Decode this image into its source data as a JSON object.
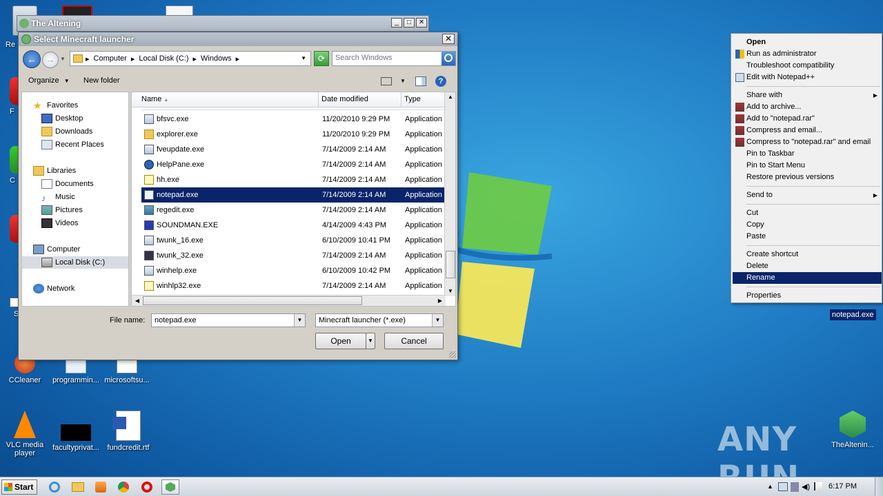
{
  "desktop": {
    "icons": [
      {
        "label": "CCleaner"
      },
      {
        "label": "programmin..."
      },
      {
        "label": "microsoftsu..."
      },
      {
        "label": "VLC media player"
      },
      {
        "label": "facultyprivat..."
      },
      {
        "label": "fundcredit.rtf"
      },
      {
        "label": "TheAltenin..."
      }
    ],
    "edge_labels": [
      "Re",
      "F",
      "C",
      "S"
    ],
    "watermark": "ANY RUN"
  },
  "back_window": {
    "title": "The Altening"
  },
  "dialog": {
    "title": "Select Minecraft launcher",
    "breadcrumbs": [
      "Computer",
      "Local Disk (C:)",
      "Windows"
    ],
    "search_placeholder": "Search Windows",
    "toolbar": {
      "organize": "Organize",
      "new_folder": "New folder"
    },
    "nav": [
      {
        "label": "Favorites"
      },
      {
        "label": "Desktop"
      },
      {
        "label": "Downloads"
      },
      {
        "label": "Recent Places"
      },
      {
        "label": "Libraries"
      },
      {
        "label": "Documents"
      },
      {
        "label": "Music"
      },
      {
        "label": "Pictures"
      },
      {
        "label": "Videos"
      },
      {
        "label": "Computer"
      },
      {
        "label": "Local Disk (C:)"
      },
      {
        "label": "Network"
      }
    ],
    "columns": {
      "name": "Name",
      "date": "Date modified",
      "type": "Type"
    },
    "files": [
      {
        "name": "bfsvc.exe",
        "date": "11/20/2010 9:29 PM",
        "type": "Application"
      },
      {
        "name": "explorer.exe",
        "date": "11/20/2010 9:29 PM",
        "type": "Application"
      },
      {
        "name": "fveupdate.exe",
        "date": "7/14/2009 2:14 AM",
        "type": "Application"
      },
      {
        "name": "HelpPane.exe",
        "date": "7/14/2009 2:14 AM",
        "type": "Application"
      },
      {
        "name": "hh.exe",
        "date": "7/14/2009 2:14 AM",
        "type": "Application"
      },
      {
        "name": "notepad.exe",
        "date": "7/14/2009 2:14 AM",
        "type": "Application"
      },
      {
        "name": "regedit.exe",
        "date": "7/14/2009 2:14 AM",
        "type": "Application"
      },
      {
        "name": "SOUNDMAN.EXE",
        "date": "4/14/2009 4:43 PM",
        "type": "Application"
      },
      {
        "name": "twunk_16.exe",
        "date": "6/10/2009 10:41 PM",
        "type": "Application"
      },
      {
        "name": "twunk_32.exe",
        "date": "7/14/2009 2:14 AM",
        "type": "Application"
      },
      {
        "name": "winhelp.exe",
        "date": "6/10/2009 10:42 PM",
        "type": "Application"
      },
      {
        "name": "winhlp32.exe",
        "date": "7/14/2009 2:14 AM",
        "type": "Application"
      }
    ],
    "selected_file": "notepad.exe",
    "file_name_label": "File name:",
    "file_name_value": "notepad.exe",
    "file_type_value": "Minecraft launcher (*.exe)",
    "open_label": "Open",
    "cancel_label": "Cancel"
  },
  "context_menu": {
    "items": [
      {
        "label": "Open"
      },
      {
        "label": "Run as administrator"
      },
      {
        "label": "Troubleshoot compatibility"
      },
      {
        "label": "Edit with Notepad++"
      },
      {
        "label": "Share with"
      },
      {
        "label": "Add to archive..."
      },
      {
        "label": "Add to \"notepad.rar\""
      },
      {
        "label": "Compress and email..."
      },
      {
        "label": "Compress to \"notepad.rar\" and email"
      },
      {
        "label": "Pin to Taskbar"
      },
      {
        "label": "Pin to Start Menu"
      },
      {
        "label": "Restore previous versions"
      },
      {
        "label": "Send to"
      },
      {
        "label": "Cut"
      },
      {
        "label": "Copy"
      },
      {
        "label": "Paste"
      },
      {
        "label": "Create shortcut"
      },
      {
        "label": "Delete"
      },
      {
        "label": "Rename"
      },
      {
        "label": "Properties"
      }
    ],
    "highlighted": "Rename"
  },
  "desktop_selected_file": "notepad.exe",
  "taskbar": {
    "start_label": "Start",
    "time": "6:17 PM"
  },
  "colors": {
    "selection": "#0a246a",
    "desktop": "#1f7cc4"
  }
}
